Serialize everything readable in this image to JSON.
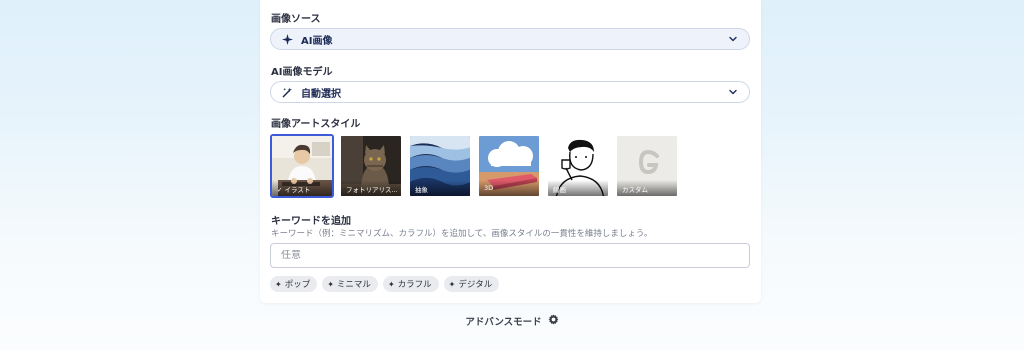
{
  "image_source": {
    "label": "画像ソース",
    "selected": "AI画像",
    "icon": "sparkle-icon"
  },
  "model": {
    "label": "AI画像モデル",
    "selected": "自動選択",
    "icon": "magic-wand-icon"
  },
  "art_style": {
    "label": "画像アートスタイル",
    "options": [
      {
        "label": "✓ イラスト",
        "selected": true
      },
      {
        "label": "フォトリアリス...",
        "selected": false
      },
      {
        "label": "抽象",
        "selected": false
      },
      {
        "label": "3D",
        "selected": false
      },
      {
        "label": "線画",
        "selected": false
      },
      {
        "label": "カスタム",
        "selected": false
      }
    ]
  },
  "keywords": {
    "label": "キーワードを追加",
    "description": "キーワード（例：ミニマリズム、カラフル）を追加して、画像スタイルの一貫性を維持しましょう。",
    "placeholder": "任意",
    "chips": [
      "ポップ",
      "ミニマル",
      "カラフル",
      "デジタル"
    ]
  },
  "advanced_mode": {
    "label": "アドバンスモード",
    "icon": "gear-icon"
  },
  "colors": {
    "accent": "#3b5bd8",
    "select_bg": "#edf2fb",
    "chip_bg": "#e9ebef"
  }
}
